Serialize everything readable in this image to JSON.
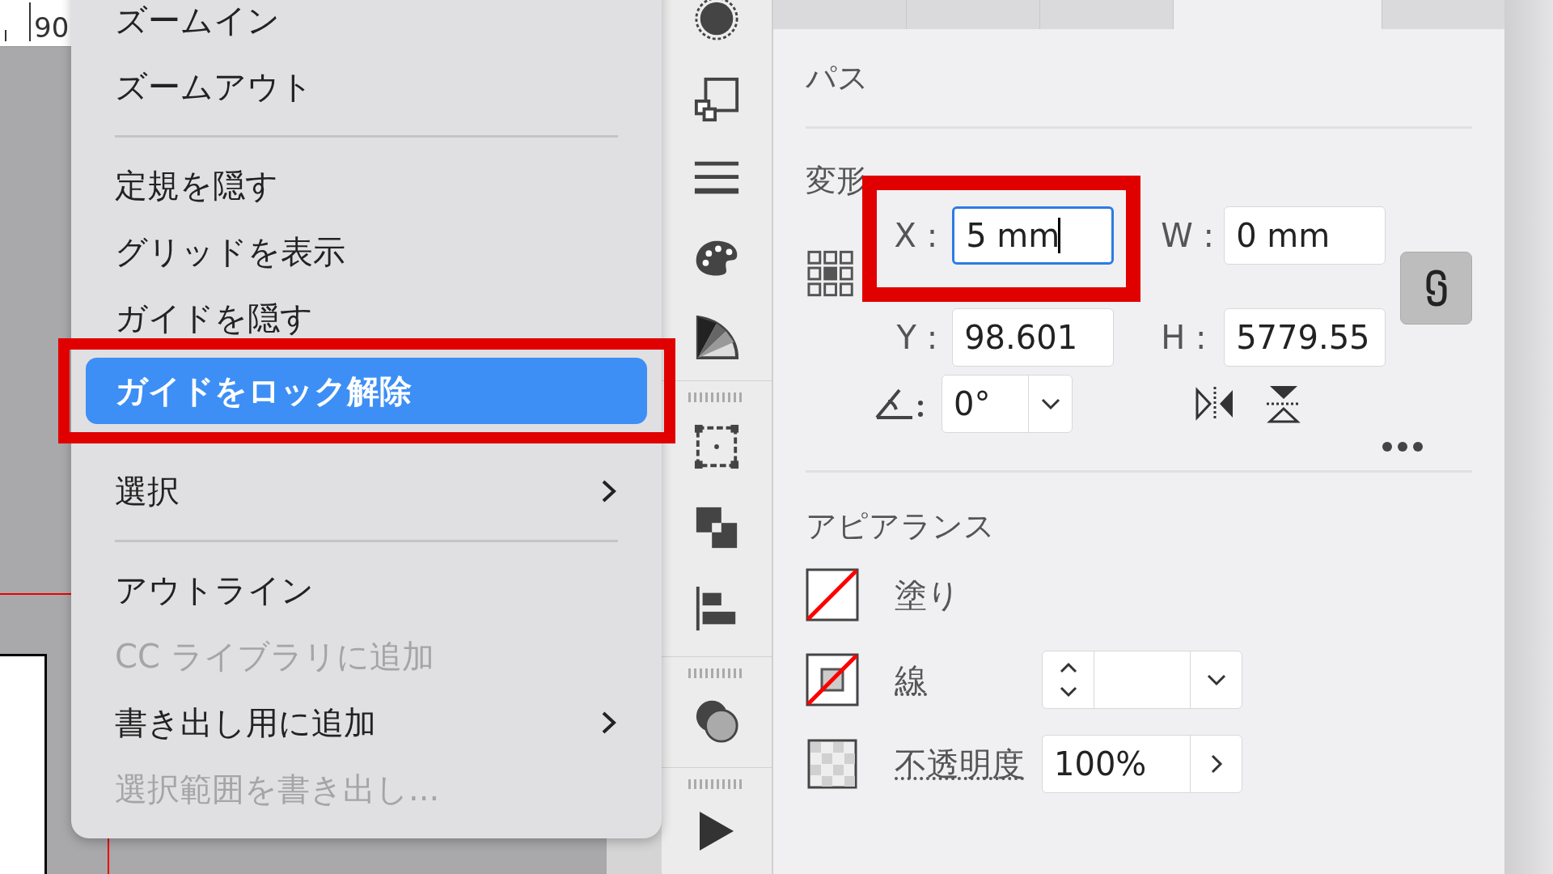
{
  "canvas": {
    "ruler_label": "90"
  },
  "context_menu": {
    "items": [
      {
        "kind": "item",
        "label": "ズームイン",
        "disabled": false,
        "selected": false,
        "submenu": false
      },
      {
        "kind": "item",
        "label": "ズームアウト",
        "disabled": false,
        "selected": false,
        "submenu": false
      },
      {
        "kind": "separator"
      },
      {
        "kind": "item",
        "label": "定規を隠す",
        "disabled": false,
        "selected": false,
        "submenu": false
      },
      {
        "kind": "item",
        "label": "グリッドを表示",
        "disabled": false,
        "selected": false,
        "submenu": false
      },
      {
        "kind": "item",
        "label": "ガイドを隠す",
        "disabled": false,
        "selected": false,
        "submenu": false
      },
      {
        "kind": "item",
        "label": "ガイドをロック解除",
        "disabled": false,
        "selected": true,
        "submenu": false
      },
      {
        "kind": "item",
        "label": "選択",
        "disabled": false,
        "selected": false,
        "submenu": true
      },
      {
        "kind": "separator"
      },
      {
        "kind": "item",
        "label": "アウトライン",
        "disabled": false,
        "selected": false,
        "submenu": false
      },
      {
        "kind": "item",
        "label": "CC ライブラリに追加",
        "disabled": true,
        "selected": false,
        "submenu": false
      },
      {
        "kind": "item",
        "label": "書き出し用に追加",
        "disabled": false,
        "selected": false,
        "submenu": true
      },
      {
        "kind": "item",
        "label": "選択範囲を書き出し...",
        "disabled": true,
        "selected": false,
        "submenu": false
      }
    ]
  },
  "properties_panel": {
    "tabs": [
      {
        "selected": false
      },
      {
        "selected": false
      },
      {
        "selected": false
      },
      {
        "selected": true
      }
    ],
    "title": "パス",
    "transform": {
      "title": "変形",
      "x": {
        "label": "X :",
        "value": "5 mm",
        "focused": true
      },
      "y": {
        "label": "Y :",
        "value": "98.601",
        "focused": false
      },
      "w": {
        "label": "W :",
        "value": "0 mm",
        "focused": false
      },
      "h": {
        "label": "H :",
        "value": "5779.55",
        "focused": false
      },
      "constrain_proportions": true,
      "angle": {
        "value": "0°"
      }
    },
    "appearance": {
      "title": "アピアランス",
      "fill": {
        "label": "塗り"
      },
      "stroke": {
        "label": "線"
      },
      "opacity": {
        "label": "不透明度",
        "value": "100%"
      }
    }
  }
}
